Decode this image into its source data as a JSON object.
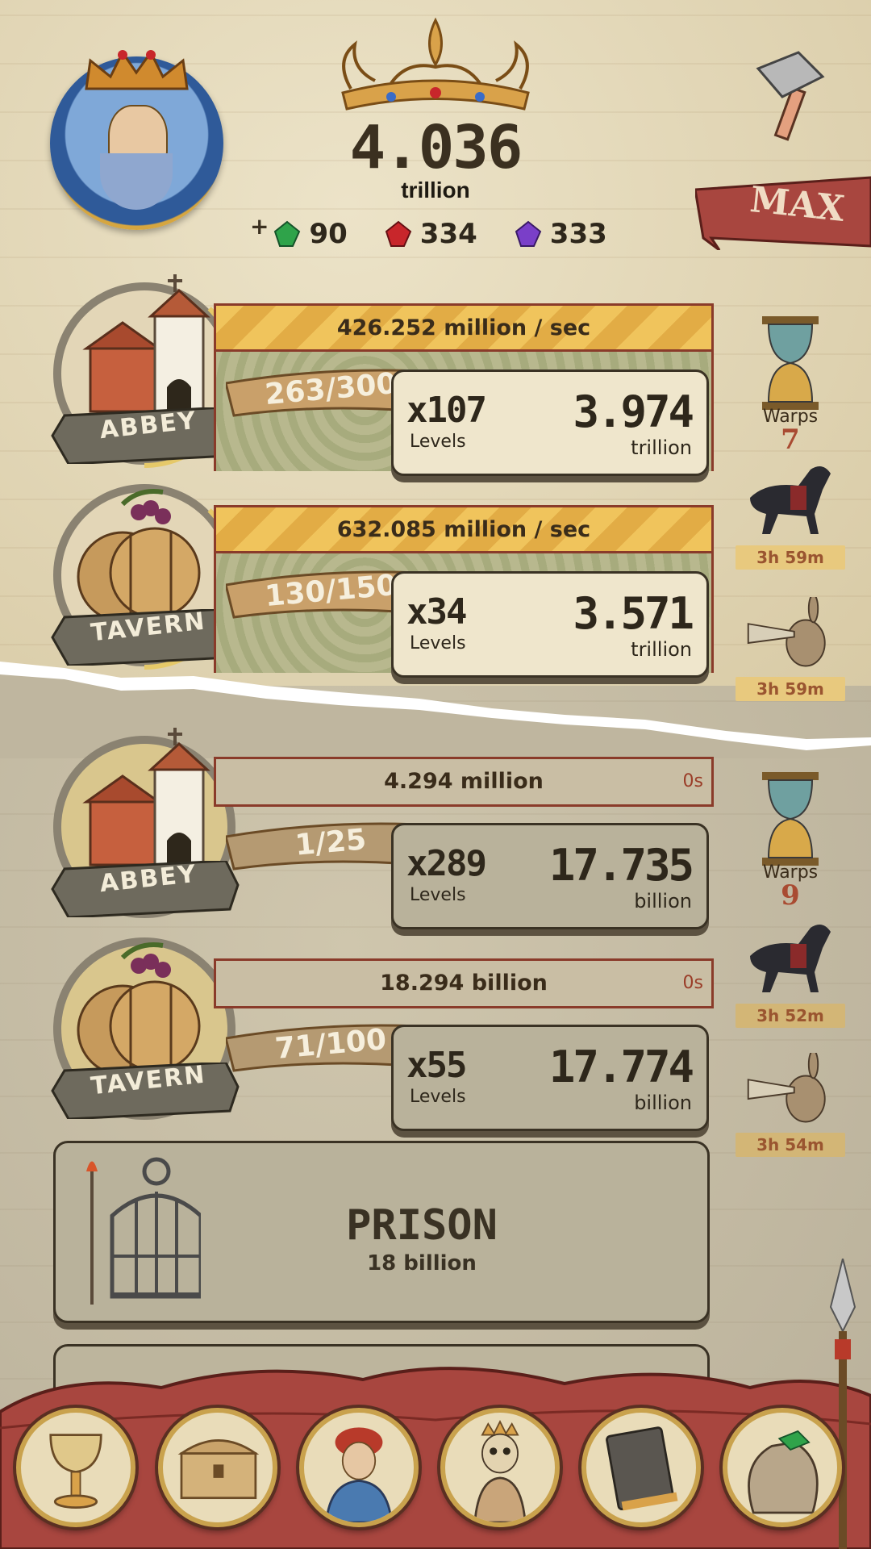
{
  "header": {
    "currency_value": "4.036",
    "currency_unit": "trillion",
    "gems": [
      {
        "name": "green-gem-icon",
        "color": "#2fa34a",
        "value": "90"
      },
      {
        "name": "red-gem-icon",
        "color": "#c8262b",
        "value": "334"
      },
      {
        "name": "purple-gem-icon",
        "color": "#7a3fc8",
        "value": "333"
      }
    ],
    "max_label": "MAX"
  },
  "current_realm": {
    "buildings": [
      {
        "name": "ABBEY",
        "rate": "426.252 million / sec",
        "progress": "263/300",
        "multiplier": "x107",
        "levels_label": "Levels",
        "value": "3.974",
        "unit": "trillion"
      },
      {
        "name": "TAVERN",
        "rate": "632.085 million / sec",
        "progress": "130/150",
        "multiplier": "x34",
        "levels_label": "Levels",
        "value": "3.571",
        "unit": "trillion"
      }
    ],
    "side": {
      "warps_label": "Warps",
      "warps_count": "7",
      "horse_timer": "3h 59m",
      "rabbit_timer": "3h 59m"
    }
  },
  "next_realm": {
    "buildings": [
      {
        "name": "ABBEY",
        "rate": "4.294 million",
        "time": "0s",
        "progress": "1/25",
        "multiplier": "x289",
        "levels_label": "Levels",
        "value": "17.735",
        "unit": "billion"
      },
      {
        "name": "TAVERN",
        "rate": "18.294 billion",
        "time": "0s",
        "progress": "71/100",
        "multiplier": "x55",
        "levels_label": "Levels",
        "value": "17.774",
        "unit": "billion"
      }
    ],
    "side": {
      "warps_label": "Warps",
      "warps_count": "9",
      "horse_timer": "3h 52m",
      "rabbit_timer": "3h 54m"
    },
    "prison": {
      "title": "PRISON",
      "cost": "18 billion"
    }
  },
  "nav": [
    "chalice-icon",
    "chest-icon",
    "noble-icon",
    "skeleton-king-icon",
    "book-icon",
    "sack-icon"
  ],
  "colors": {
    "accent_gold": "#f0c45c",
    "banner_red": "#a8463f",
    "border_brown": "#8a3b2a",
    "timer_text": "#9a5530"
  }
}
